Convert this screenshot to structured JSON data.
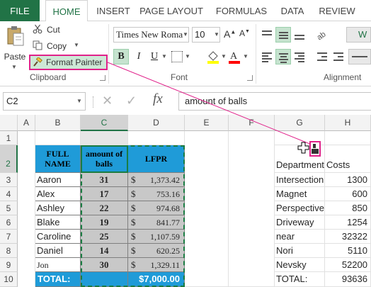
{
  "tabs": [
    "FILE",
    "HOME",
    "INSERT",
    "PAGE LAYOUT",
    "FORMULAS",
    "DATA",
    "REVIEW"
  ],
  "clipboard": {
    "paste_label": "Paste",
    "cut_label": "Cut",
    "copy_label": "Copy",
    "format_painter_label": "Format Painter",
    "group_label": "Clipboard"
  },
  "font": {
    "name": "Times New Roma",
    "size": "10",
    "bold_label": "B",
    "italic_label": "I",
    "underline_label": "U",
    "group_label": "Font"
  },
  "alignment": {
    "group_label": "Alignment",
    "wrap_label": "W"
  },
  "formula_bar": {
    "name_box": "C2",
    "cancel_glyph": "✕",
    "enter_glyph": "✓",
    "fx_label": "fx",
    "formula": "amount of balls"
  },
  "columns": [
    "A",
    "B",
    "C",
    "D",
    "E",
    "F",
    "G",
    "H"
  ],
  "rows": [
    "1",
    "2",
    "3",
    "4",
    "5",
    "6",
    "7",
    "8",
    "9",
    "10"
  ],
  "table": {
    "header_name": "FULL NAME",
    "header_balls": "amount of balls",
    "header_lfpr": "LFPR",
    "rows": [
      {
        "name": "Aaron",
        "balls": "31",
        "currency": "$",
        "lfpr": "1,373.42"
      },
      {
        "name": "Alex",
        "balls": "17",
        "currency": "$",
        "lfpr": "753.16"
      },
      {
        "name": "Ashley",
        "balls": "22",
        "currency": "$",
        "lfpr": "974.68"
      },
      {
        "name": "Blake",
        "balls": "19",
        "currency": "$",
        "lfpr": "841.77"
      },
      {
        "name": "Caroline",
        "balls": "25",
        "currency": "$",
        "lfpr": "1,107.59"
      },
      {
        "name": "Daniel",
        "balls": "14",
        "currency": "$",
        "lfpr": "620.25"
      },
      {
        "name": "Jon",
        "balls": "30",
        "currency": "$",
        "lfpr": "1,329.11"
      }
    ],
    "total_label": "TOTAL:",
    "total_value": "$7,000.00"
  },
  "side": {
    "header_dept": "Department",
    "header_costs": "Costs",
    "rows": [
      {
        "dept": "Intersection",
        "cost": "1300"
      },
      {
        "dept": "Magnet",
        "cost": "600"
      },
      {
        "dept": "Perspective",
        "cost": "850"
      },
      {
        "dept": "Driveway",
        "cost": "1254"
      },
      {
        "dept": "near",
        "cost": "32322"
      },
      {
        "dept": "Nori",
        "cost": "5110"
      },
      {
        "dept": "Nevsky",
        "cost": "52200"
      }
    ],
    "total_label": "TOTAL:",
    "total_value": "93636"
  },
  "colors": {
    "excel_green": "#217346",
    "table_header_blue": "#1f9bd8",
    "highlight_pink": "#e0218a",
    "selection_gray": "#c8c8c8"
  }
}
